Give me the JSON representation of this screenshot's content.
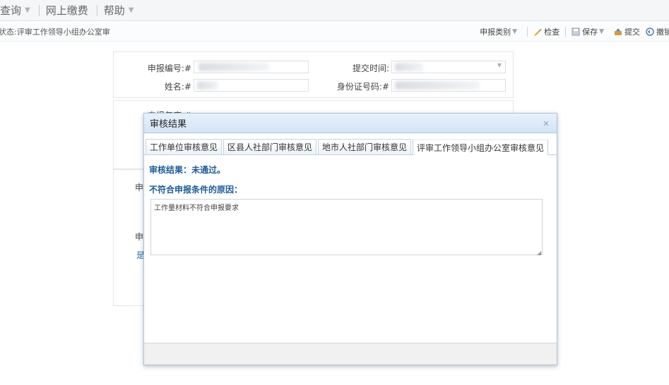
{
  "menubar": {
    "items": [
      {
        "label": "查询",
        "has_caret": true
      },
      {
        "label": "网上缴费",
        "has_caret": false
      },
      {
        "label": "帮助",
        "has_caret": true
      }
    ]
  },
  "statusbar": {
    "status_text": "状态:评审工作领导小组办公室审"
  },
  "toolbar": {
    "category_label": "申报类别",
    "check_label": "检查",
    "save_label": "保存",
    "submit_label": "提交",
    "revoke_label": "撤销"
  },
  "form": {
    "app_no_label": "申报编号:#",
    "submit_time_label": "提交时间:",
    "name_label": "姓名:#",
    "id_label": "身份证号码:#",
    "year_label": "申报年度:#",
    "side_char_1": "申",
    "side_char_2": "申",
    "side_char_3": "是"
  },
  "dialog": {
    "title": "审核结果",
    "close_icon": "close-icon",
    "tabs": [
      {
        "label": "工作单位审核意见",
        "active": false
      },
      {
        "label": "区县人社部门审核意见",
        "active": false
      },
      {
        "label": "地市人社部门审核意见",
        "active": false
      },
      {
        "label": "评审工作领导小组办公室审核意见",
        "active": true
      }
    ],
    "result_text": "审核结果：未通过。",
    "reason_label": "不符合申报条件的原因：",
    "reason_value": "工作量材料不符合申报要求"
  }
}
